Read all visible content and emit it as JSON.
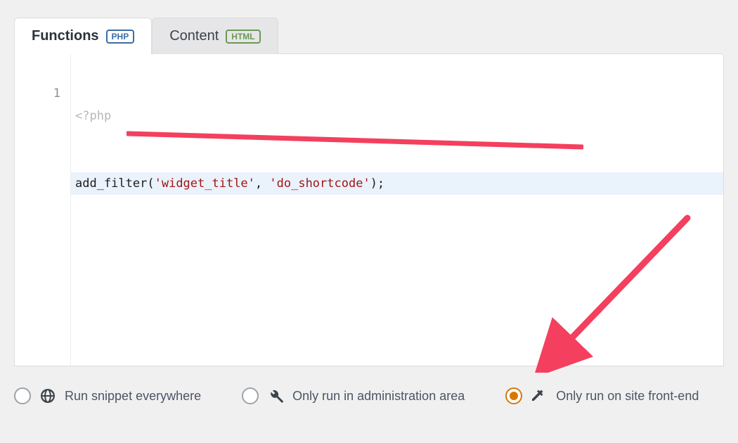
{
  "tabs": {
    "functions": {
      "label": "Functions",
      "badge": "PHP"
    },
    "content": {
      "label": "Content",
      "badge": "HTML"
    }
  },
  "code": {
    "open_tag": "<?php",
    "line1": {
      "fn": "add_filter",
      "p_open": "(",
      "arg1": "'widget_title'",
      "comma": ", ",
      "arg2": "'do_shortcode'",
      "p_close": ");"
    }
  },
  "gutter": {
    "l1": "1"
  },
  "options": {
    "everywhere": "Run snippet everywhere",
    "admin": "Only run in administration area",
    "front": "Only run on site front-end"
  },
  "colors": {
    "accent": "#d97706",
    "annotation": "#f43f5e"
  }
}
